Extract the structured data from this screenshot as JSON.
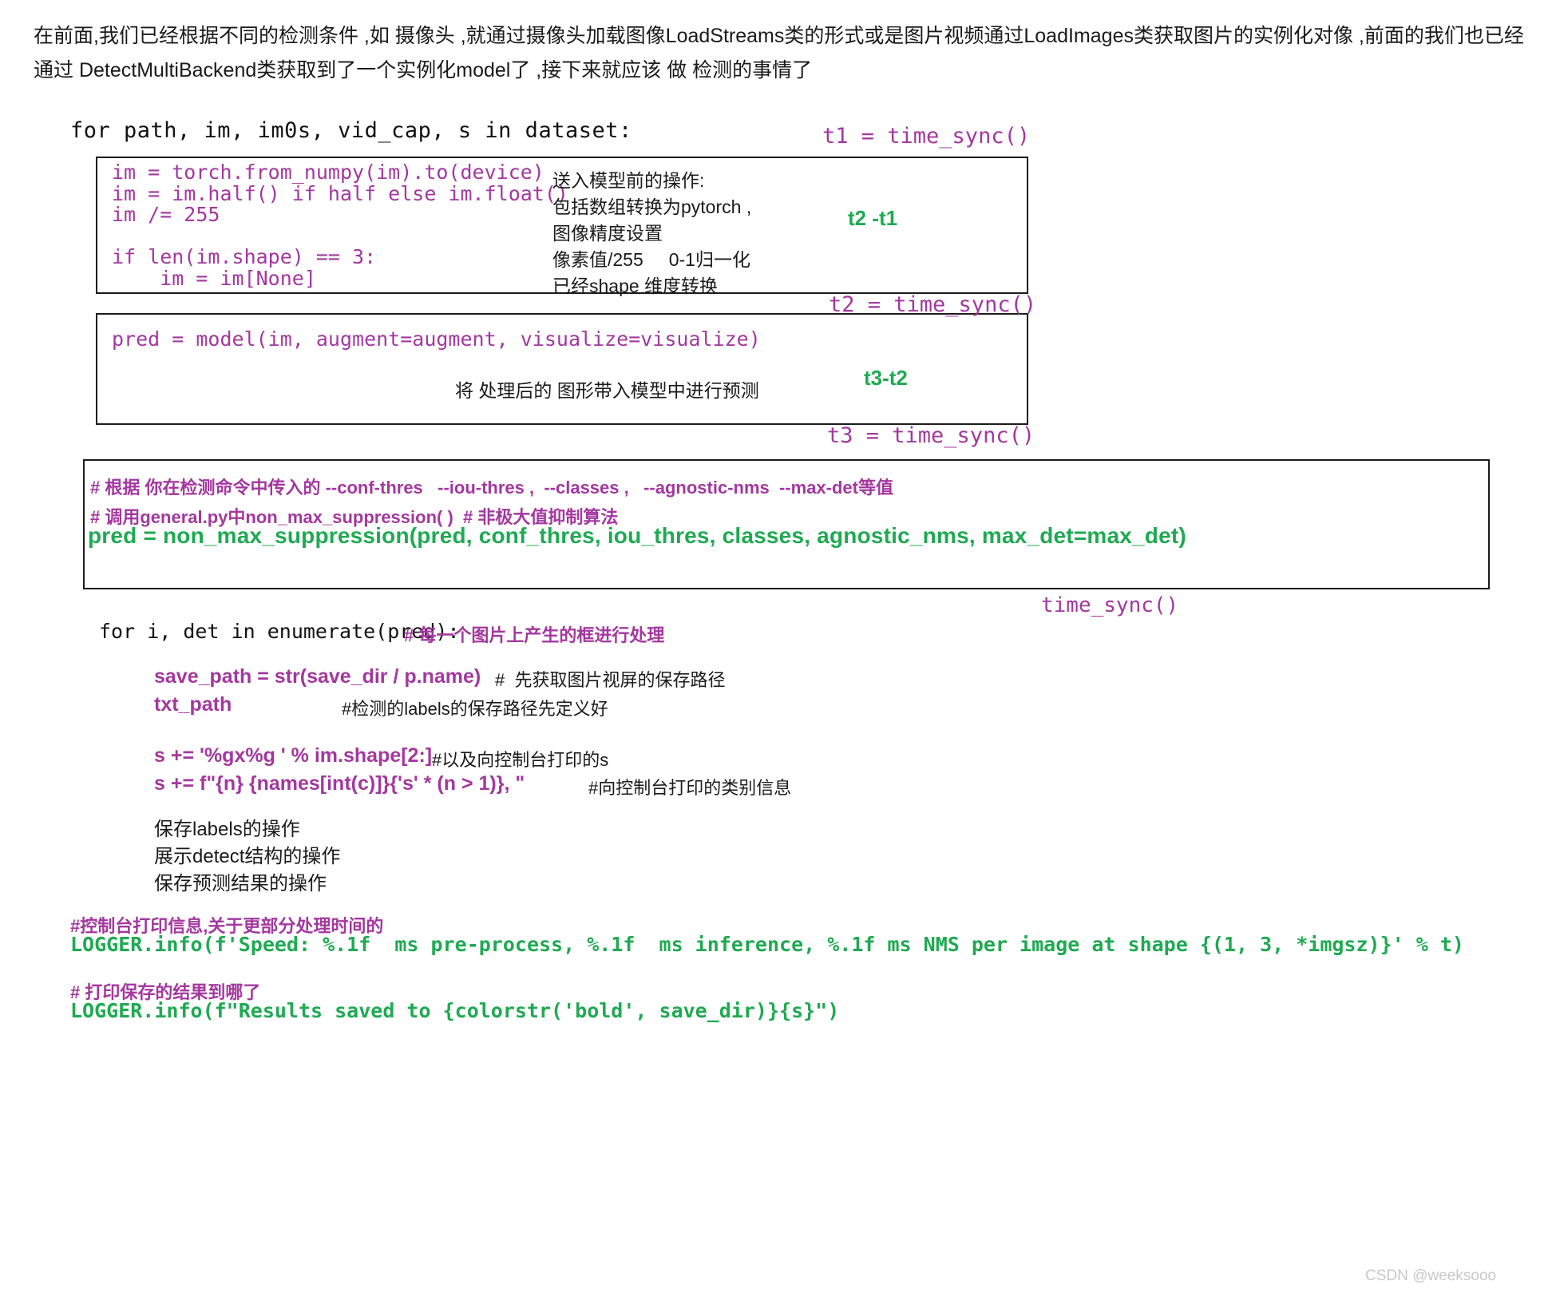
{
  "intro": {
    "paragraph": "在前面,我们已经根据不同的检测条件 ,如  摄像头 ,就通过摄像头加载图像LoadStreams类的形式或是图片视频通过LoadImages类获取图片的实例化对像 ,前面的我们也已经通过 DetectMultiBackend类获取到了一个实例化model了 ,接下来就应该 做 检测的事情了"
  },
  "loop": {
    "for_dataset": "for path, im, im0s, vid_cap, s in dataset:"
  },
  "preprocess_box": {
    "code": "im = torch.from_numpy(im).to(device)\nim = im.half() if half else im.float()\nim /= 255\n\nif len(im.shape) == 3:\n    im = im[None]",
    "note": "送入模型前的操作:\n包括数组转换为pytorch ,\n图像精度设置\n像素值/255     0-1归一化\n已经shape 维度转换"
  },
  "predict_box": {
    "code": "pred = model(im, augment=augment, visualize=visualize)",
    "note": "将 处理后的 图形带入模型中进行预测"
  },
  "timers": {
    "t1": "t1 = time_sync()",
    "t2_minus_t1": "t2 -t1",
    "t2": "t2 = time_sync()",
    "t3_minus_t2": "t3-t2",
    "t3": "t3 = time_sync()",
    "time_sync_bare": "time_sync()"
  },
  "nms_box": {
    "comment1": "# 根据 你在检测命令中传入的 --conf-thres   --iou-thres ,  --classes ,   --agnostic-nms  --max-det等值",
    "comment2": "# 调用general.py中non_max_suppression( )  # 非极大值抑制算法",
    "code": "pred = non_max_suppression(pred, conf_thres, iou_thres, classes, agnostic_nms, max_det=max_det)"
  },
  "detect_loop": {
    "for_enumerate": "for i, det in enumerate(pred):",
    "for_enumerate_comment": "# 每一个图片上产生的框进行处理",
    "save_path": "save_path = str(save_dir / p.name)",
    "save_path_comment": "#  先获取图片视屏的保存路径",
    "txt_path": "txt_path",
    "txt_path_comment": "#检测的labels的保存路径先定义好",
    "s_line1": "s += '%gx%g ' % im.shape[2:]",
    "s_line1_comment": "#以及向控制台打印的s",
    "s_line2": "s += f\"{n} {names[int(c)]}{'s' * (n > 1)}, \"",
    "s_line2_comment": "#向控制台打印的类别信息",
    "operations": "保存labels的操作\n展示detect结构的操作\n保存预测结果的操作"
  },
  "logging": {
    "comment1": "#控制台打印信息,关于更部分处理时间的",
    "line1": "LOGGER.info(f'Speed: %.1f  ms pre-process, %.1f  ms inference, %.1f ms NMS per image at shape {(1, 3, *imgsz)}' % t)",
    "comment2": "# 打印保存的结果到哪了",
    "line2": "LOGGER.info(f\"Results saved to {colorstr('bold', save_dir)}{s}\")"
  },
  "watermark": {
    "text": "CSDN @weeksooo"
  },
  "colors": {
    "purple": "#a3389f",
    "green": "#1faa52",
    "black": "#121212",
    "watermark_gray": "#c8c8c8"
  }
}
